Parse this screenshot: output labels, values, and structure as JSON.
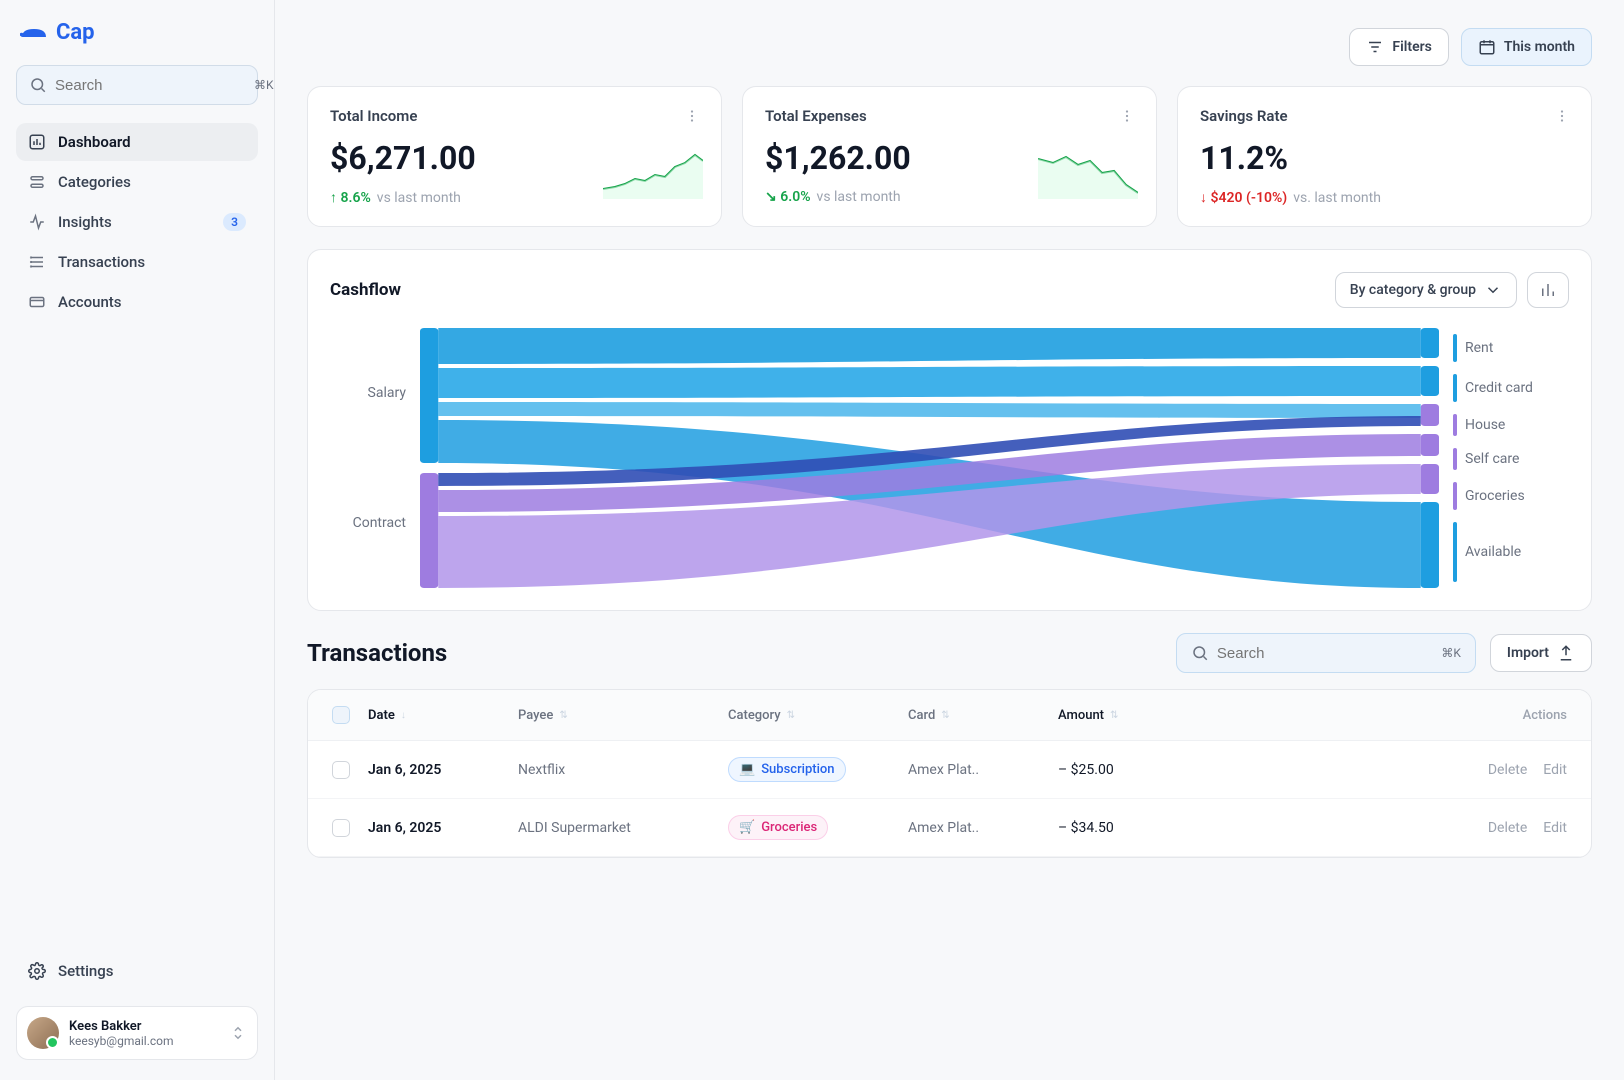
{
  "app": {
    "name": "Cap"
  },
  "sidebar": {
    "search_placeholder": "Search",
    "search_kbd": "⌘K",
    "items": [
      {
        "label": "Dashboard"
      },
      {
        "label": "Categories"
      },
      {
        "label": "Insights",
        "badge": "3"
      },
      {
        "label": "Transactions"
      },
      {
        "label": "Accounts"
      }
    ],
    "settings_label": "Settings",
    "user": {
      "name": "Kees Bakker",
      "email": "keesyb@gmail.com"
    }
  },
  "topbar": {
    "filters": "Filters",
    "period": "This month"
  },
  "cards": [
    {
      "title": "Total Income",
      "value": "$6,271.00",
      "change": "8.6%",
      "sub": "vs last month",
      "dir": "up"
    },
    {
      "title": "Total Expenses",
      "value": "$1,262.00",
      "change": "6.0%",
      "sub": "vs last month",
      "dir": "down-green"
    },
    {
      "title": "Savings Rate",
      "value": "11.2%",
      "change": "$420 (-10%)",
      "sub": "vs. last month",
      "dir": "down-red"
    }
  ],
  "cashflow": {
    "title": "Cashflow",
    "group_by": "By category & group"
  },
  "chart_data": {
    "type": "sankey",
    "sources": [
      "Salary",
      "Contract"
    ],
    "targets": [
      "Rent",
      "Credit card",
      "House",
      "Self care",
      "Groceries",
      "Available"
    ],
    "links_note": "Salary flows primarily to Rent, Credit card, House, Self care and Available (blue); Contract flows primarily to Groceries, Self care and House (purple). Exact values not labeled on chart.",
    "colors": {
      "salary": "#1e9ee0",
      "contract": "#9e7ce0"
    }
  },
  "transactions": {
    "title": "Transactions",
    "search_placeholder": "Search",
    "search_kbd": "⌘K",
    "import_label": "Import",
    "columns": {
      "date": "Date",
      "payee": "Payee",
      "category": "Category",
      "card": "Card",
      "amount": "Amount",
      "actions": "Actions"
    },
    "rows": [
      {
        "date": "Jan 6, 2025",
        "payee": "Nextflix",
        "category": "Subscription",
        "cat_kind": "sub",
        "card": "Amex Plat..",
        "amount": "– $25.00"
      },
      {
        "date": "Jan 6, 2025",
        "payee": "ALDI Supermarket",
        "category": "Groceries",
        "cat_kind": "gro",
        "card": "Amex Plat..",
        "amount": "– $34.50"
      }
    ],
    "actions": {
      "delete": "Delete",
      "edit": "Edit"
    }
  }
}
